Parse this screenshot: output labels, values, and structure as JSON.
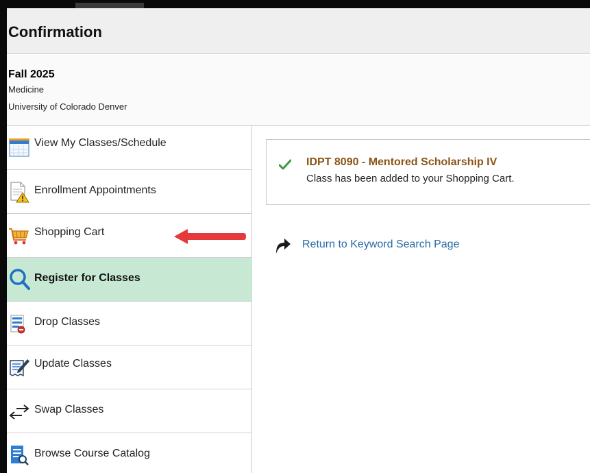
{
  "header": {
    "title": "Confirmation"
  },
  "term": {
    "name": "Fall 2025",
    "career": "Medicine",
    "institution": "University of Colorado Denver"
  },
  "sidebar": {
    "items": [
      {
        "label": "View My Classes/Schedule",
        "icon": "calendar-icon",
        "active": false
      },
      {
        "label": "Enrollment Appointments",
        "icon": "document-warning-icon",
        "active": false
      },
      {
        "label": "Shopping Cart",
        "icon": "shopping-cart-icon",
        "active": false
      },
      {
        "label": "Register for Classes",
        "icon": "search-icon",
        "active": true
      },
      {
        "label": "Drop Classes",
        "icon": "drop-list-icon",
        "active": false
      },
      {
        "label": "Update Classes",
        "icon": "edit-document-icon",
        "active": false
      },
      {
        "label": "Swap Classes",
        "icon": "swap-arrows-icon",
        "active": false
      },
      {
        "label": "Browse Course Catalog",
        "icon": "catalog-search-icon",
        "active": false
      }
    ]
  },
  "confirmation": {
    "class_title": "IDPT 8090 - Mentored Scholarship IV",
    "message": "Class has been added to your Shopping Cart."
  },
  "return_link": {
    "label": "Return to Keyword Search Page",
    "icon": "return-arrow-icon"
  },
  "colors": {
    "active_item_bg": "#c7e8d3",
    "class_title": "#8b5416",
    "link": "#2a6aa8",
    "check": "#3a9a3a",
    "annotation_arrow": "#e5393b"
  }
}
